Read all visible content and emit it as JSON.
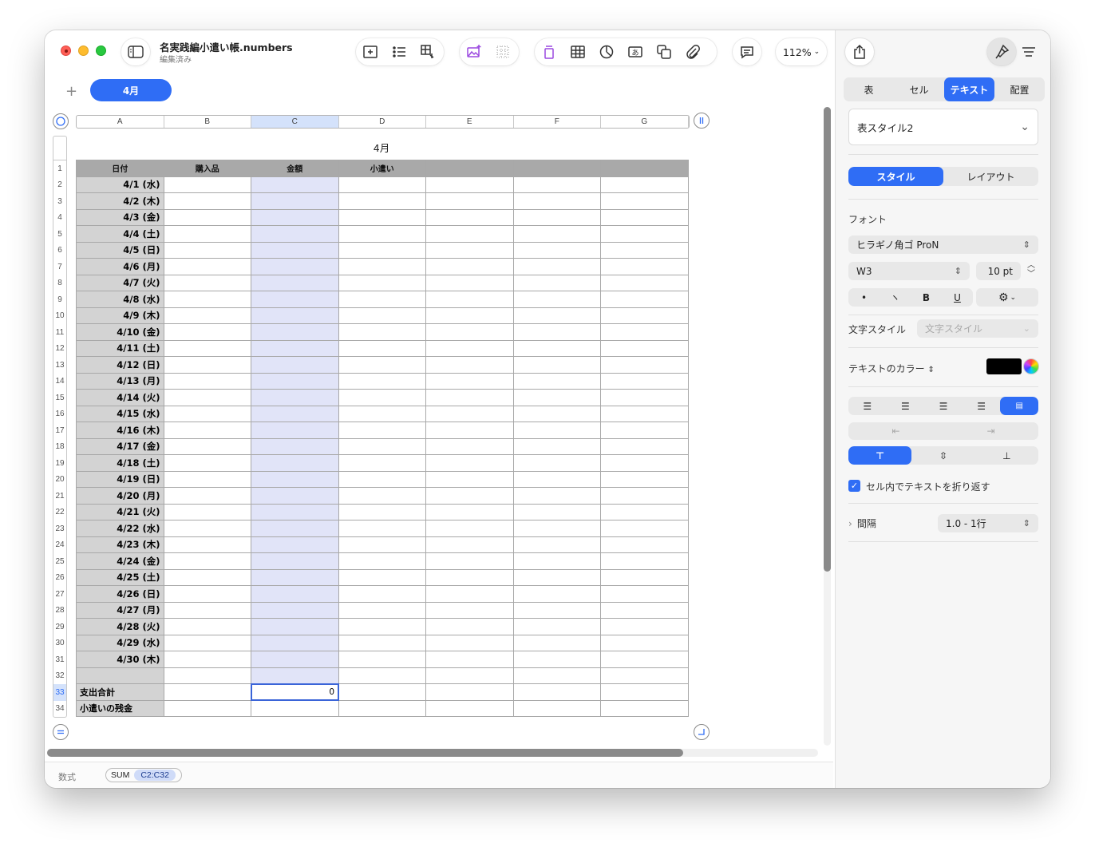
{
  "window": {
    "title": "名実践編小遣い帳.numbers",
    "subtitle": "編集済み",
    "zoom": "112%"
  },
  "sheet_tabs": [
    {
      "label": "4月",
      "active": true
    }
  ],
  "table": {
    "title": "4月",
    "column_letters": [
      "A",
      "B",
      "C",
      "D",
      "E",
      "F",
      "G"
    ],
    "selected_column": "C",
    "header_row": [
      "日付",
      "購入品",
      "金額",
      "小遣い",
      "",
      "",
      ""
    ],
    "dates": [
      "4/1 (水)",
      "4/2 (木)",
      "4/3 (金)",
      "4/4 (土)",
      "4/5 (日)",
      "4/6 (月)",
      "4/7 (火)",
      "4/8 (水)",
      "4/9 (木)",
      "4/10 (金)",
      "4/11 (土)",
      "4/12 (日)",
      "4/13 (月)",
      "4/14 (火)",
      "4/15 (水)",
      "4/16 (木)",
      "4/17 (金)",
      "4/18 (土)",
      "4/19 (日)",
      "4/20 (月)",
      "4/21 (火)",
      "4/22 (水)",
      "4/23 (木)",
      "4/24 (金)",
      "4/25 (土)",
      "4/26 (日)",
      "4/27 (月)",
      "4/28 (火)",
      "4/29 (水)",
      "4/30 (木)"
    ],
    "row_numbers": [
      "1",
      "2",
      "3",
      "4",
      "5",
      "6",
      "7",
      "8",
      "9",
      "10",
      "11",
      "12",
      "13",
      "14",
      "15",
      "16",
      "17",
      "18",
      "19",
      "20",
      "21",
      "22",
      "23",
      "24",
      "25",
      "26",
      "27",
      "28",
      "29",
      "30",
      "31",
      "32",
      "33",
      "34"
    ],
    "selected_row": "33",
    "footer": [
      {
        "label": "支出合計",
        "value": "0"
      },
      {
        "label": "小遣いの残金",
        "value": ""
      }
    ]
  },
  "formula_bar": {
    "label": "数式",
    "function": "SUM",
    "reference": "C2:C32"
  },
  "sidebar": {
    "tabs": [
      "表",
      "セル",
      "テキスト",
      "配置"
    ],
    "active_tab": "テキスト",
    "table_style": "表スタイル2",
    "sub_tabs": [
      "スタイル",
      "レイアウト"
    ],
    "active_sub_tab": "スタイル",
    "font_section_label": "フォント",
    "font_family": "ヒラギノ角ゴ ProN",
    "font_weight": "W3",
    "font_size": "10 pt",
    "format_buttons": [
      "•",
      "ヽ",
      "B",
      "U"
    ],
    "char_style_label": "文字スタイル",
    "char_style_placeholder": "文字スタイル",
    "text_color_label": "テキストのカラー",
    "text_color": "#000000",
    "wrap_label": "セル内でテキストを折り返す",
    "wrap_checked": true,
    "spacing_label": "間隔",
    "spacing_value": "1.0 - 1行"
  },
  "colors": {
    "accent": "#2f6df5",
    "selected_column_fill": "#e1e4f8",
    "header_fill": "#a9a9a9",
    "label_fill": "#d3d3d3"
  }
}
